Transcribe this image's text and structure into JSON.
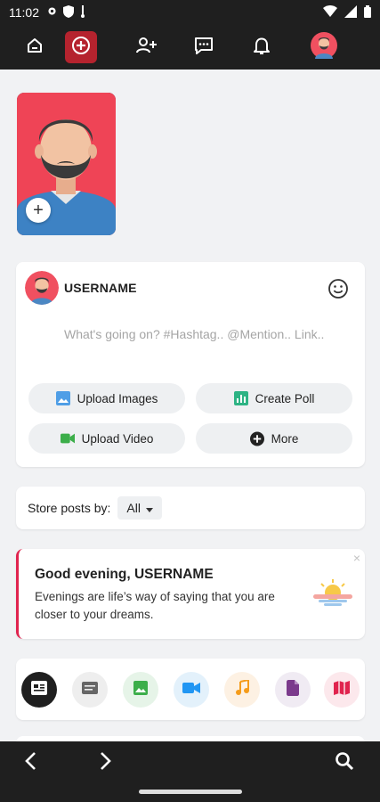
{
  "status_bar": {
    "time": "11:02"
  },
  "top_nav": {
    "items": [
      {
        "icon": "home-icon"
      },
      {
        "icon": "create-post-icon",
        "active": true
      },
      {
        "icon": "add-friend-icon"
      },
      {
        "icon": "messages-icon"
      },
      {
        "icon": "notifications-icon"
      },
      {
        "icon": "profile-avatar"
      }
    ]
  },
  "story": {
    "add_label": "+"
  },
  "composer": {
    "username": "USERNAME",
    "placeholder": "What's going on? #Hashtag.. @Mention.. Link..",
    "buttons": {
      "upload_images": "Upload Images",
      "create_poll": "Create Poll",
      "upload_video": "Upload Video",
      "more": "More"
    }
  },
  "sort": {
    "label": "Store posts by:",
    "selected": "All"
  },
  "greeting": {
    "title": "Good evening, USERNAME",
    "text": "Evenings are life’s way of saying that you are closer to your dreams.",
    "close": "×"
  },
  "filters": [
    {
      "icon": "all-posts-icon",
      "bg": "#1f1f1f"
    },
    {
      "icon": "text-icon",
      "bg": "#eeeeee"
    },
    {
      "icon": "photos-icon",
      "bg": "#e6f4e8"
    },
    {
      "icon": "video-icon",
      "bg": "#e3f1fb"
    },
    {
      "icon": "music-icon",
      "bg": "#fdf1e3"
    },
    {
      "icon": "file-icon",
      "bg": "#f0ebf3"
    },
    {
      "icon": "map-icon",
      "bg": "#fce8ec"
    }
  ],
  "colors": {
    "accent": "#b5232e",
    "brand_red": "#e0234e",
    "bar": "#1f1f1f"
  }
}
